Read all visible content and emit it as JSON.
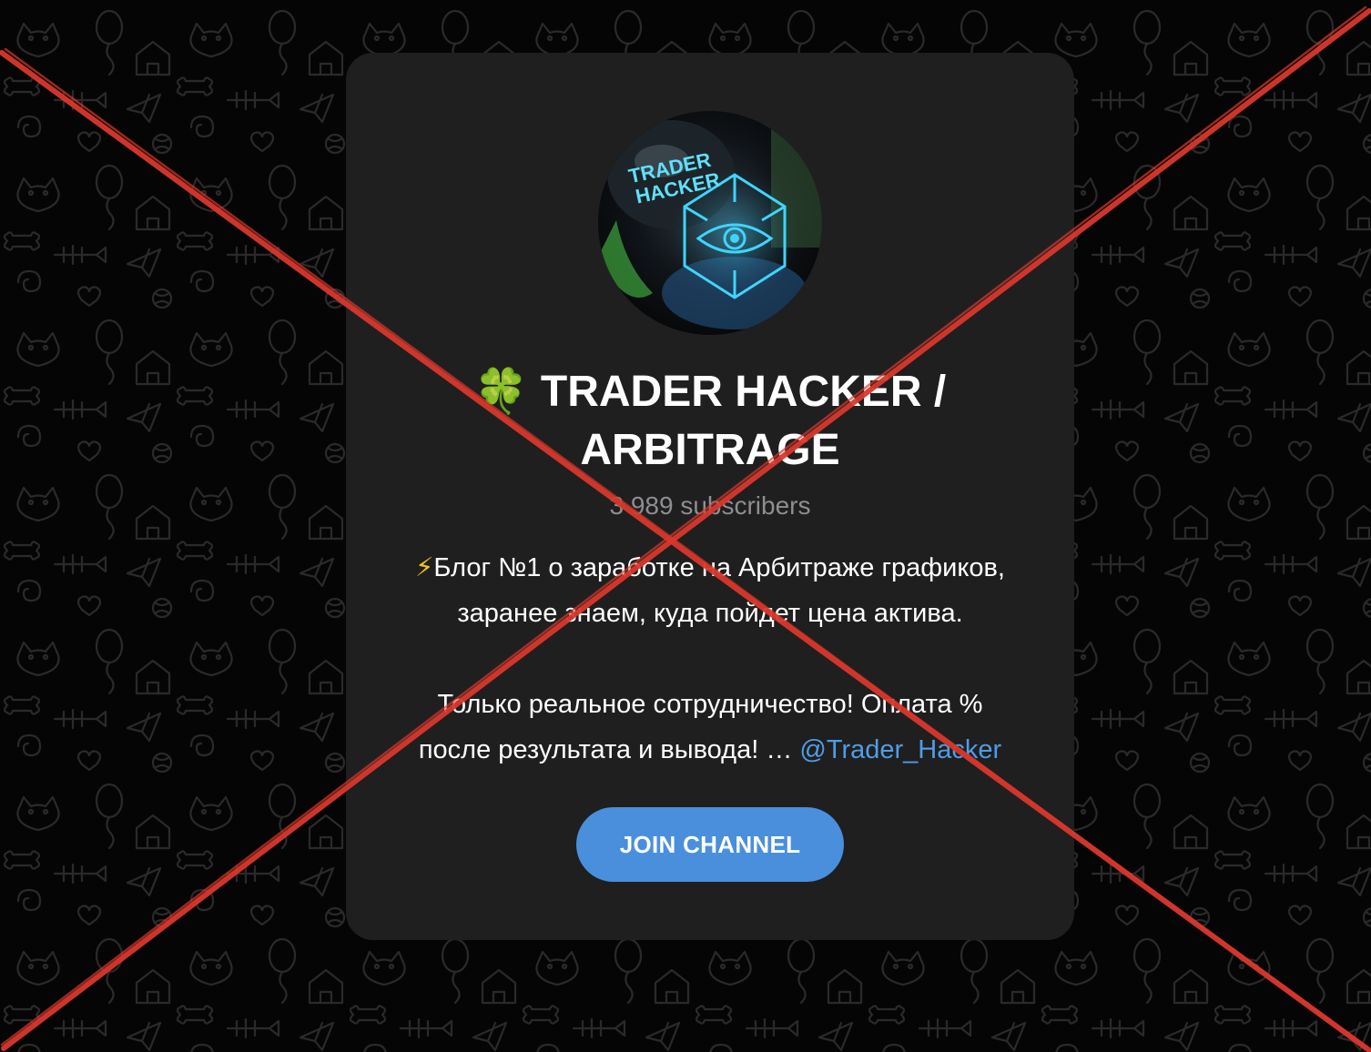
{
  "channel": {
    "title_emoji": "🍀",
    "title_line1": "TRADER HACKER /",
    "title_line2": "ARBITRAGE",
    "avatar_text_line1": "TRADER",
    "avatar_text_line2": "HACKER",
    "subscribers": "3 989 subscribers",
    "description": {
      "bolt": "⚡",
      "line1": "Блог №1 о заработке на Арбитраже графиков,",
      "line2": "заранее знаем, куда пойдет цена актива.",
      "line3": "Только реальное сотрудничество! Оплата %",
      "line4_text": "после результата и вывода! … ",
      "line4_link": "@Trader_Hacker"
    },
    "join_label": "JOIN CHANNEL"
  },
  "colors": {
    "background": "#050505",
    "card": "#1f1f20",
    "button": "#4a8fdc",
    "link": "#4f9de6",
    "cross": "#d9382c"
  },
  "icons": [
    "clover-icon",
    "lightning-icon",
    "cross-out-mark"
  ]
}
